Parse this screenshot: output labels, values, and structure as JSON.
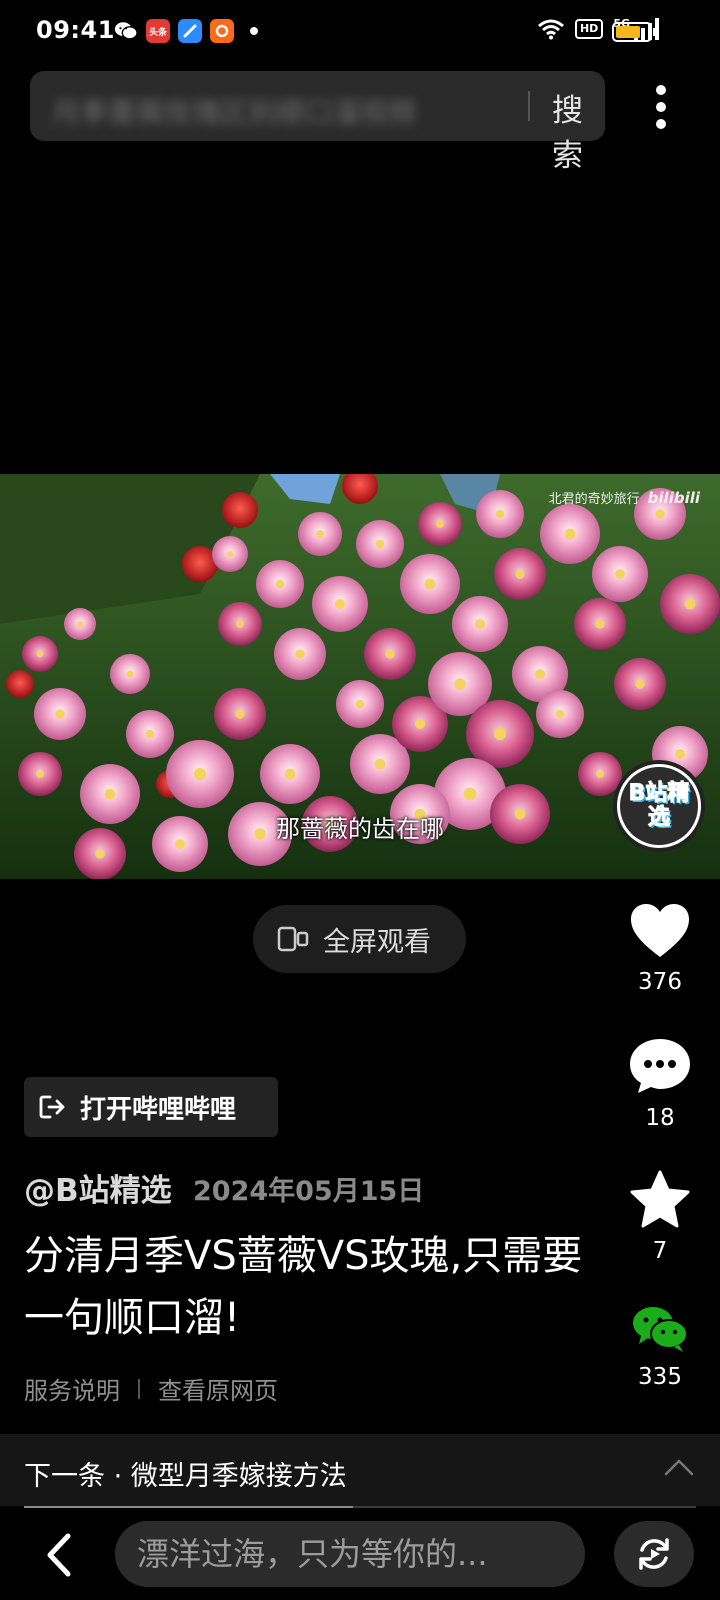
{
  "status_bar": {
    "time": "09:41",
    "app_icons": [
      "wechat-icon",
      "toutiao-icon",
      "browser-icon",
      "app-icon"
    ],
    "toutiao_label": "头条",
    "network": "5G",
    "hd_label": "HD",
    "battery_level": 0.75,
    "battery_color": "#f6b51c"
  },
  "search": {
    "query": "月季蔷薇玫瑰区别顺口溜视频",
    "button_label": "搜索"
  },
  "video": {
    "watermark_text": "北君的奇妙旅行",
    "watermark_brand": "bilibili",
    "subtitle": "那蔷薇的齿在哪",
    "badge_text": "B站精选"
  },
  "fullscreen_label": "全屏观看",
  "actions": {
    "like_count": "376",
    "comment_count": "18",
    "favorite_count": "7",
    "share_count": "335",
    "share_color": "#1aad19"
  },
  "open_app_label": "打开哔哩哔哩",
  "post": {
    "author": "@B站精选",
    "date": "2024年05月15日",
    "title": "分清月季VS蔷薇VS玫瑰,只需要一句顺口溜!"
  },
  "footer_links": {
    "service": "服务说明",
    "original": "查看原网页"
  },
  "next": {
    "label": "下一条 · 微型月季嫁接方法",
    "progress": 0.49
  },
  "bottom_bar": {
    "comment_placeholder": "漂洋过海，只为等你的..."
  }
}
